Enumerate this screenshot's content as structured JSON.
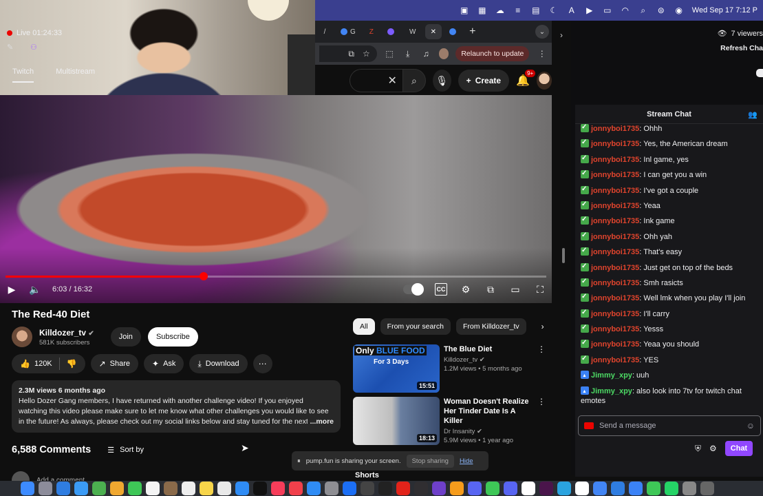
{
  "menubar": {
    "datetime": "Wed Sep 17  7:12 P"
  },
  "browser": {
    "tabs": [
      "/",
      "G",
      "Z",
      "",
      "W",
      "",
      "G"
    ],
    "relaunch_label": "Relaunch to update",
    "create_label": "Create",
    "notif_badge": "9+"
  },
  "player": {
    "time": "6:03 / 16:32",
    "progress_fraction": 0.366
  },
  "video": {
    "title": "The Red-40 Diet",
    "channel": "Killdozer_tv",
    "subscribers": "581K subscribers",
    "join_label": "Join",
    "subscribe_label": "Subscribe",
    "likes": "120K",
    "share_label": "Share",
    "ask_label": "Ask",
    "download_label": "Download",
    "meta": "2.3M views  6 months ago",
    "description": "Hello Dozer Gang members, I have returned with another challenge video! If you enjoyed watching this video please make sure to let me know what other challenges you would like to see in the future! As always, please check out my social links below and stay tuned for the next video!",
    "more_label": "...more"
  },
  "comments": {
    "count": "6,588 Comments",
    "sort_label": "Sort by",
    "add_placeholder": "Add a comment..."
  },
  "related": {
    "chips": [
      "All",
      "From your search",
      "From Killdozer_tv"
    ],
    "items": [
      {
        "title": "The Blue Diet",
        "channel": "Killdozer_tv",
        "stats": "1.2M views • 5 months ago",
        "duration": "15:51",
        "thumb_head_a": "Only",
        "thumb_head_b": "BLUE FOOD",
        "thumb_sub": "For 3 Days"
      },
      {
        "title": "Woman Doesn't Realize Her Tinder Date Is A Killer",
        "channel": "Dr Insanity",
        "stats": "5.9M views • 1 year ago",
        "duration": "18:13"
      }
    ],
    "shorts_label": "Shorts"
  },
  "screenshare": {
    "message": "pump.fun is sharing your screen.",
    "stop_label": "Stop sharing",
    "hide_label": "Hide"
  },
  "stream": {
    "live": "Live 01:24:33",
    "viewers": "7 viewers",
    "refresh_label": "Refresh Cha",
    "tabs": [
      "Twitch",
      "Multistream"
    ],
    "chat_title": "Stream Chat",
    "input_placeholder": "Send a message",
    "chat_button": "Chat",
    "messages": [
      {
        "user": "jonnyboi1735",
        "text": ": Ohhh",
        "color": "#e0442d",
        "badge": "green"
      },
      {
        "user": "jonnyboi1735",
        "text": ": Yes, the American dream",
        "color": "#e0442d",
        "badge": "green"
      },
      {
        "user": "jonnyboi1735",
        "text": ": Inl game, yes",
        "color": "#e0442d",
        "badge": "green"
      },
      {
        "user": "jonnyboi1735",
        "text": ": I can get you a win",
        "color": "#e0442d",
        "badge": "green"
      },
      {
        "user": "jonnyboi1735",
        "text": ": I've got a couple",
        "color": "#e0442d",
        "badge": "green"
      },
      {
        "user": "jonnyboi1735",
        "text": ": Yeaa",
        "color": "#e0442d",
        "badge": "green"
      },
      {
        "user": "jonnyboi1735",
        "text": ": Ink game",
        "color": "#e0442d",
        "badge": "green"
      },
      {
        "user": "jonnyboi1735",
        "text": ": Ohh yah",
        "color": "#e0442d",
        "badge": "green"
      },
      {
        "user": "jonnyboi1735",
        "text": ": That's easy",
        "color": "#e0442d",
        "badge": "green"
      },
      {
        "user": "jonnyboi1735",
        "text": ": Just get on top of the beds",
        "color": "#e0442d",
        "badge": "green"
      },
      {
        "user": "jonnyboi1735",
        "text": ": Smh rasicts",
        "color": "#e0442d",
        "badge": "green"
      },
      {
        "user": "jonnyboi1735",
        "text": ": Well lmk when you play I'll join",
        "color": "#e0442d",
        "badge": "green"
      },
      {
        "user": "jonnyboi1735",
        "text": ": I'll carry",
        "color": "#e0442d",
        "badge": "green"
      },
      {
        "user": "jonnyboi1735",
        "text": ": Yesss",
        "color": "#e0442d",
        "badge": "green"
      },
      {
        "user": "jonnyboi1735",
        "text": ": Yeaa you should",
        "color": "#e0442d",
        "badge": "green"
      },
      {
        "user": "jonnyboi1735",
        "text": ": YES",
        "color": "#e0442d",
        "badge": "green"
      },
      {
        "user": "Jimmy_xpy",
        "text": ": uuh",
        "color": "#4cd964",
        "badge": "blue"
      },
      {
        "user": "Jimmy_xpy",
        "text": ": also look into 7tv for twitch chat emotes",
        "color": "#4cd964",
        "badge": "blue"
      }
    ]
  },
  "icons": {
    "play": "play-icon",
    "volume": "volume-icon",
    "settings": "gear-icon",
    "fullscreen": "fullscreen-icon"
  },
  "colors": {
    "yt_red": "#ff0000",
    "twitch_purple": "#9147ff",
    "live_red": "#eb0400"
  }
}
